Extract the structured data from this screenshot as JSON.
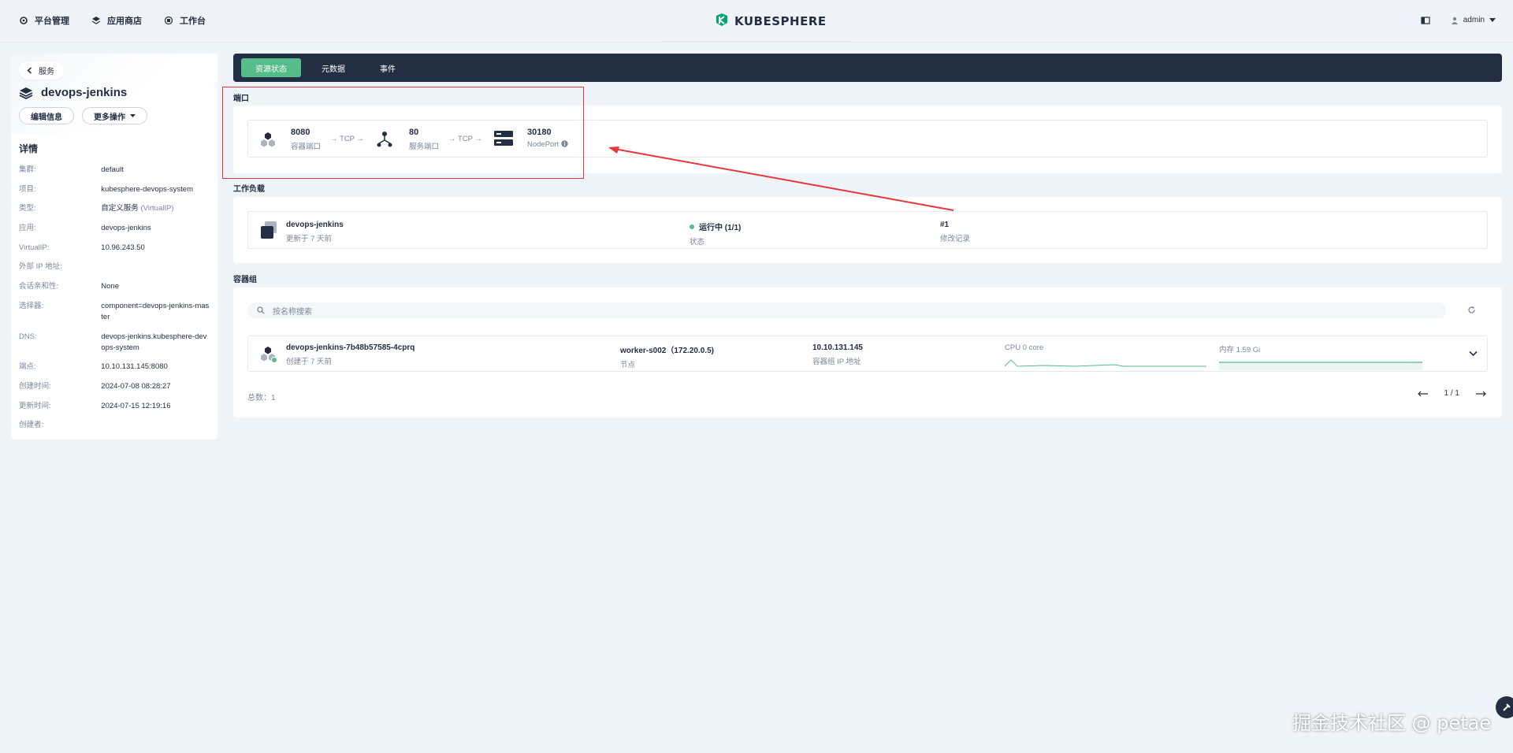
{
  "topbar": {
    "nav": [
      "平台管理",
      "应用商店",
      "工作台"
    ],
    "brand": "KUBESPHERE",
    "user": "admin"
  },
  "left": {
    "back_label": "服务",
    "service_name": "devops-jenkins",
    "edit_label": "编辑信息",
    "more_label": "更多操作",
    "details_title": "详情",
    "details": [
      {
        "k": "集群:",
        "v": "default"
      },
      {
        "k": "项目:",
        "v": "kubesphere-devops-system"
      },
      {
        "k": "类型:",
        "v": "自定义服务",
        "extra": "(VirtualIP)"
      },
      {
        "k": "应用:",
        "v": "devops-jenkins"
      },
      {
        "k": "VirtualIP:",
        "v": "10.96.243.50"
      },
      {
        "k": "外部 IP 地址:",
        "v": ""
      },
      {
        "k": "会话亲和性:",
        "v": "None"
      },
      {
        "k": "选择器:",
        "v": "component=devops-jenkins-master"
      },
      {
        "k": "DNS:",
        "v": "devops-jenkins.kubesphere-devops-system"
      },
      {
        "k": "端点:",
        "v": "10.10.131.145:8080"
      },
      {
        "k": "创建时间:",
        "v": "2024-07-08 08:28:27"
      },
      {
        "k": "更新时间:",
        "v": "2024-07-15 12:19:16"
      },
      {
        "k": "创建者:",
        "v": ""
      }
    ]
  },
  "tabs": [
    "资源状态",
    "元数据",
    "事件"
  ],
  "ports": {
    "section": "端口",
    "container_port": "8080",
    "container_port_label": "容器端口",
    "protocol1": "→ TCP →",
    "service_port": "80",
    "service_port_label": "服务端口",
    "protocol2": "→ TCP →",
    "node_port": "30180",
    "node_port_label": "NodePort"
  },
  "workload": {
    "section": "工作负载",
    "name": "devops-jenkins",
    "updated": "更新于 7 天前",
    "status": "运行中 (1/1)",
    "status_label": "状态",
    "revision": "#1",
    "revision_label": "修改记录"
  },
  "pods": {
    "section": "容器组",
    "search_placeholder": "按名称搜索",
    "pod_name": "devops-jenkins-7b48b57585-4cprq",
    "pod_created": "创建于 7 天前",
    "node": "worker-s002（172.20.0.5)",
    "node_label": "节点",
    "pod_ip": "10.10.131.145",
    "pod_ip_label": "容器组 IP 地址",
    "cpu": "CPU 0 core",
    "memory": "内存 1.59 Gi",
    "total": "总数：1",
    "page": "1 / 1"
  },
  "watermark": "掘金技术社区 @ petae",
  "colors": {
    "accent": "#55bc8a",
    "dark": "#242e42",
    "annotation": "#e5383b"
  }
}
